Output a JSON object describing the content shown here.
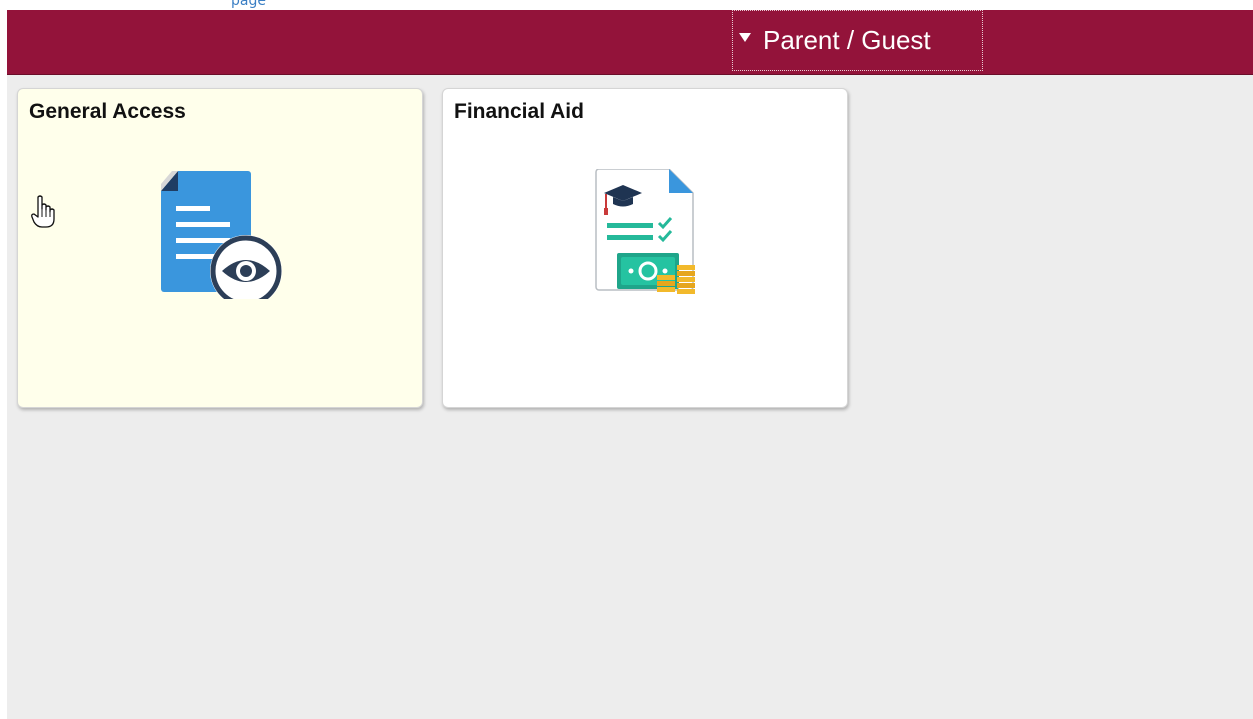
{
  "top_link": {
    "text": "page"
  },
  "header": {
    "role_label": "Parent / Guest",
    "caret_icon": "caret-down-icon",
    "background_color": "#93133a"
  },
  "tiles": [
    {
      "title": "General Access",
      "icon": "document-view-icon",
      "state": "hover"
    },
    {
      "title": "Financial Aid",
      "icon": "financial-aid-document-icon",
      "state": "normal"
    }
  ],
  "colors": {
    "brand": "#93133a",
    "content_background": "#ededed",
    "tile_hover": "#ffffeb",
    "tile_normal": "#ffffff"
  }
}
